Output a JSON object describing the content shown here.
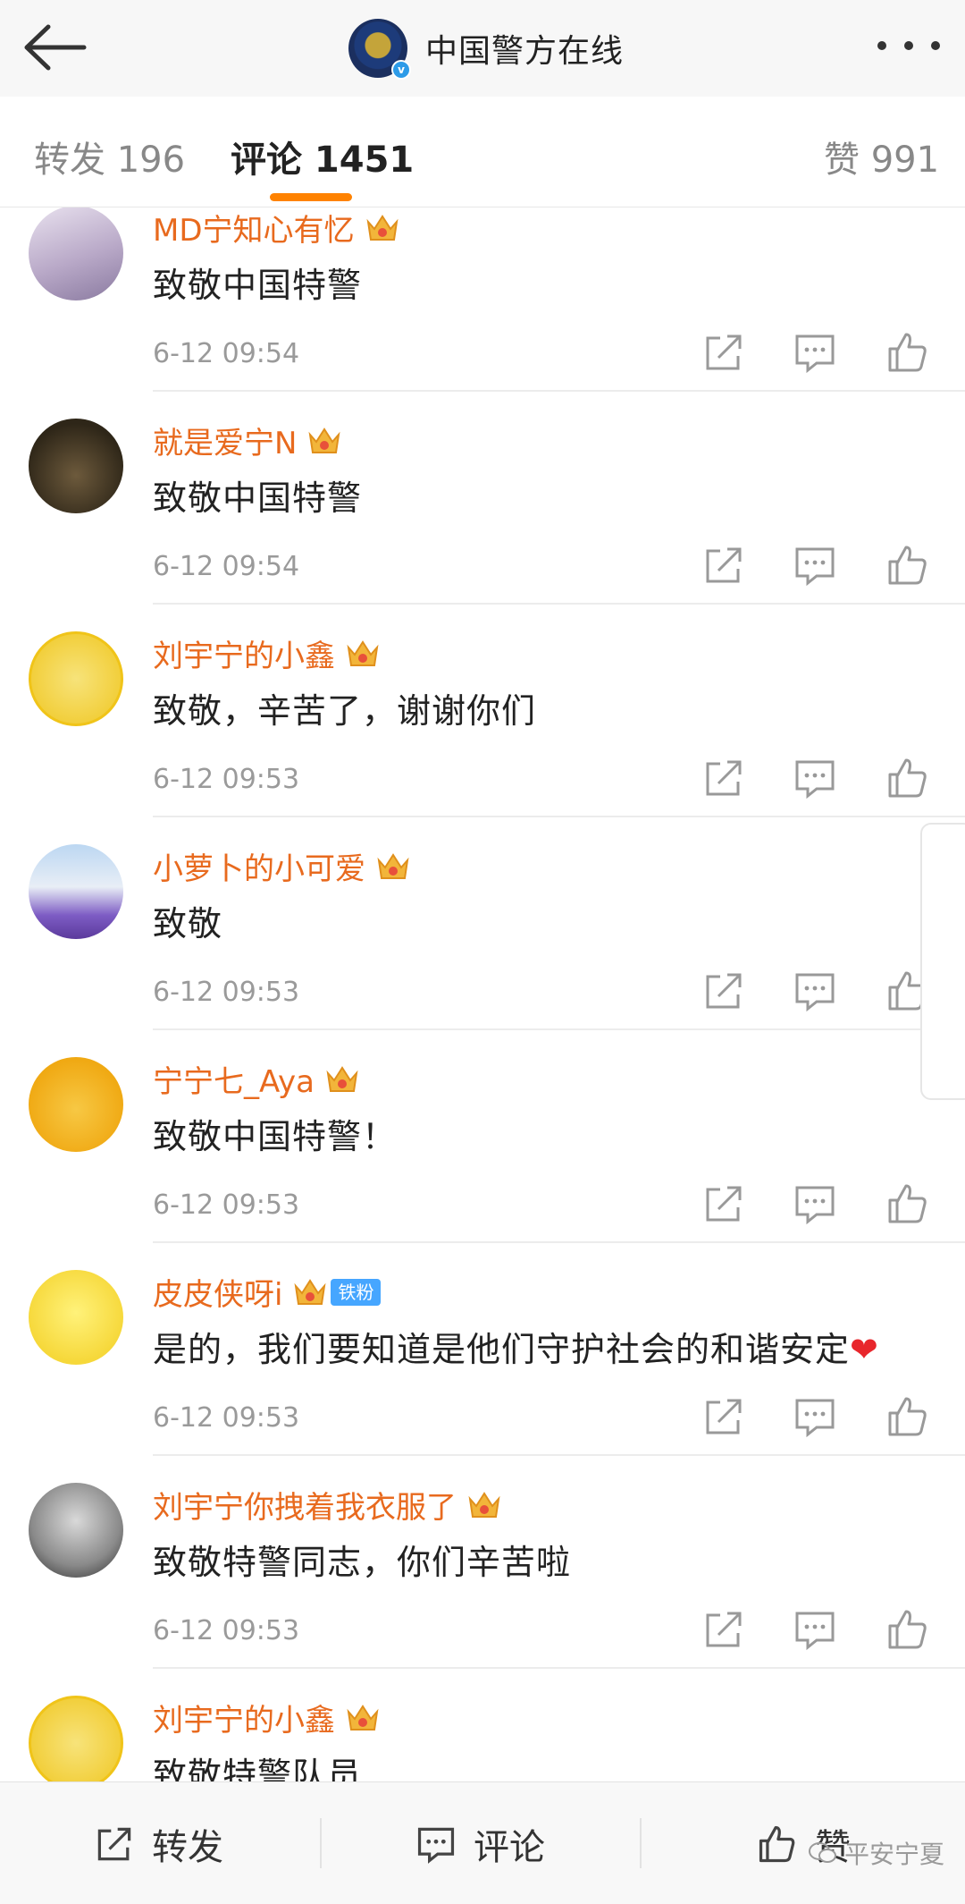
{
  "header": {
    "title": "中国警方在线"
  },
  "tabs": [
    {
      "label": "转发 196"
    },
    {
      "label": "评论 1451"
    },
    {
      "label": "赞 991"
    }
  ],
  "comments": [
    {
      "username": "MD宁知心有忆",
      "text": "致敬中国特警",
      "time": "6-12 09:54"
    },
    {
      "username": "就是爱宁N",
      "text": "致敬中国特警",
      "time": "6-12 09:54"
    },
    {
      "username": "刘宇宁的小鑫",
      "text": "致敬，辛苦了，谢谢你们",
      "time": "6-12 09:53"
    },
    {
      "username": "小萝卜的小可爱",
      "text": "致敬",
      "time": "6-12 09:53"
    },
    {
      "username": "宁宁七_Aya",
      "text": "致敬中国特警！",
      "time": "6-12 09:53"
    },
    {
      "username": "皮皮侠呀i",
      "badge": "铁粉",
      "text": "是的，我们要知道是他们守护社会的和谐安定",
      "time": "6-12 09:53"
    },
    {
      "username": "刘宇宁你拽着我衣服了",
      "text": "致敬特警同志，你们辛苦啦",
      "time": "6-12 09:53"
    },
    {
      "username": "刘宇宁的小鑫",
      "text": "致敬特警队员",
      "time": ""
    }
  ],
  "bottom": {
    "repost": "转发",
    "comment": "评论",
    "like": "赞"
  },
  "watermark": "平安宁夏",
  "colors": {
    "accent": "#ff8200",
    "username": "#e86a1e",
    "fans_badge": "#46a6ff"
  }
}
